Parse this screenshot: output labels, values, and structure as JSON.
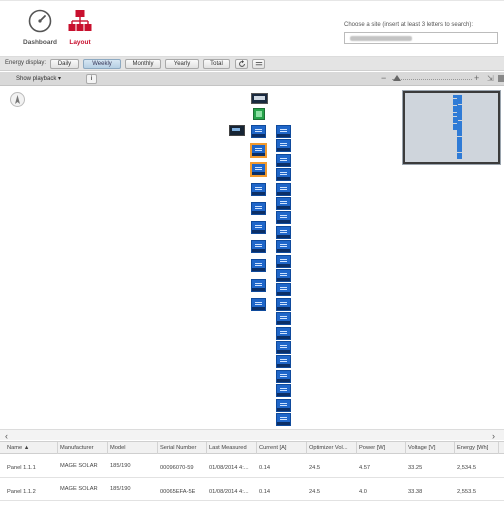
{
  "nav": {
    "dashboard_label": "Dashboard",
    "layout_label": "Layout",
    "active_color": "#c8102e"
  },
  "site": {
    "label": "Choose a site (insert at least 3 letters to search):"
  },
  "energy": {
    "label": "Energy display:",
    "periods": [
      "Daily",
      "Weekly",
      "Monthly",
      "Yearly",
      "Total"
    ],
    "active_period": "Weekly"
  },
  "playback": {
    "label": "Show playback",
    "info_label": "i"
  },
  "zoom": {
    "minus": "−",
    "plus": "+"
  },
  "layout_colors": {
    "panel": "#1f66c9",
    "selected_outline": "#f29a2e",
    "meter": "#26a34a"
  },
  "table": {
    "columns": [
      "Name ▲",
      "Manufacturer",
      "Model",
      "Serial Number",
      "Last Measured",
      "Current [A]",
      "Optimizer Vol...",
      "Power [W]",
      "Voltage [V]",
      "Energy [Wh]"
    ],
    "rows": [
      [
        "Panel 1.1.1",
        "MAGE SOLAR",
        "185/190",
        "00096070-59",
        "01/08/2014 4:...",
        "0.14",
        "24.5",
        "4.57",
        "33.25",
        "2,534.5"
      ],
      [
        "Panel 1.1.2",
        "MAGE SOLAR",
        "185/190",
        "00065EFA-5E",
        "01/08/2014 4:...",
        "0.14",
        "24.5",
        "4.0",
        "33.38",
        "2,553.5"
      ]
    ]
  }
}
